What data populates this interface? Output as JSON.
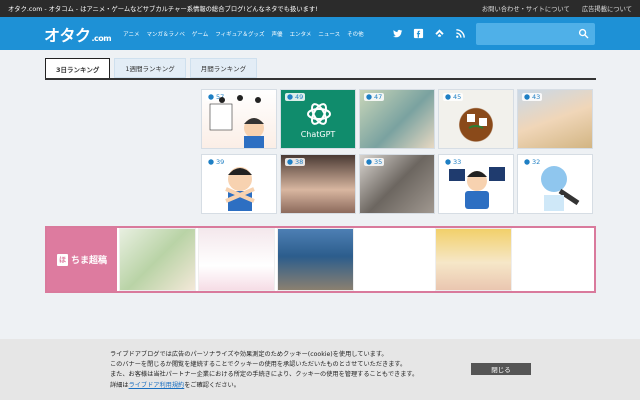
{
  "topbar": {
    "tagline": "オタク.com - オタコム - はアニメ・ゲームなどサブカルチャー系情報の総合ブログ!どんなネタでも扱います!",
    "links": [
      "お問い合わせ・サイトについて",
      "広告掲載について"
    ]
  },
  "header": {
    "logo_main": "オタク",
    "logo_suffix": ".com",
    "nav": [
      "アニメ",
      "マンガ＆ラノベ",
      "ゲーム",
      "フィギュア＆グッズ",
      "声優",
      "エンタメ",
      "ニュース",
      "その他"
    ],
    "social_icons": [
      "twitter-icon",
      "facebook-icon",
      "feedly-icon",
      "rss-icon"
    ],
    "search_placeholder": ""
  },
  "tabs": [
    "3日ランキング",
    "1週間ランキング",
    "月間ランキング"
  ],
  "ranking": [
    {
      "count": "57"
    },
    {
      "count": "49",
      "thumb_text": "ChatGPT"
    },
    {
      "count": "47"
    },
    {
      "count": "45"
    },
    {
      "count": "43"
    },
    {
      "count": "39"
    },
    {
      "count": "38"
    },
    {
      "count": "35"
    },
    {
      "count": "33"
    },
    {
      "count": "32"
    }
  ],
  "banner": {
    "mark": "ほ",
    "label": "ちま超稿"
  },
  "cookie": {
    "line1": "ライブドアブログでは広告のパーソナライズや効果測定のためクッキー(cookie)を使用しています。",
    "line2": "このバナーを閉じるか閲覧を継続することでクッキーの使用を承認いただいたものとさせていただきます。",
    "line3": "また、お客様は当社パートナー企業における所定の手続きにより、クッキーの使用を管理することもできます。",
    "line4_pre": "詳細は",
    "line4_link": "ライブドア利用規約",
    "line4_post": "をご確認ください。",
    "close": "閉じる"
  },
  "colors": {
    "header_blue": "#1e91d6",
    "topbar_dark": "#2b2b2b",
    "banner_pink": "#dd7b9f",
    "count_blue": "#1e7fc4"
  }
}
